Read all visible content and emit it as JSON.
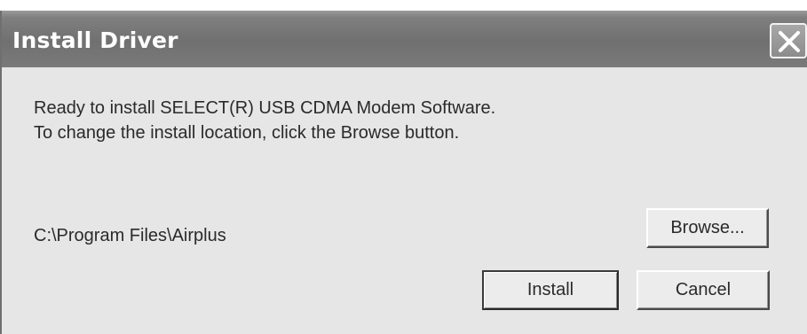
{
  "window": {
    "title": "Install Driver",
    "close_icon": "close-icon"
  },
  "message": {
    "line1": "Ready to install SELECT(R) USB CDMA Modem Software.",
    "line2": "To change the install location, click the Browse button."
  },
  "install_location": {
    "path": "C:\\Program Files\\Airplus"
  },
  "buttons": {
    "browse": "Browse...",
    "install": "Install",
    "cancel": "Cancel"
  },
  "colors": {
    "titlebar": "#7a7a7a",
    "dialog_background": "#e6e6e6",
    "title_text": "#ffffff"
  }
}
